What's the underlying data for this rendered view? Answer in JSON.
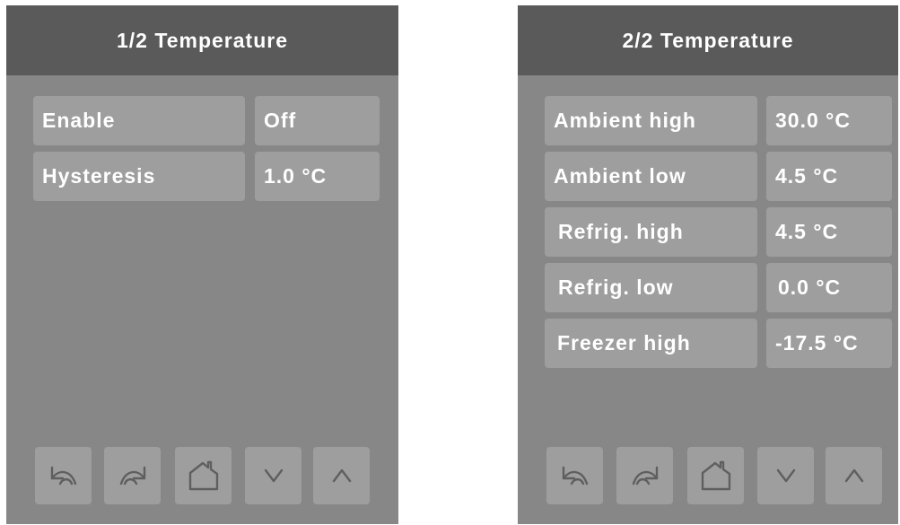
{
  "panels": [
    {
      "title": "1/2 Temperature",
      "rows": [
        {
          "label": "Enable",
          "value": "Off"
        },
        {
          "label": "Hysteresis",
          "value": "1.0 °C"
        }
      ]
    },
    {
      "title": "2/2 Temperature",
      "rows": [
        {
          "label": "Ambient high",
          "value": "30.0 °C"
        },
        {
          "label": "Ambient low",
          "value": "4.5 °C"
        },
        {
          "label": "Refrig. high",
          "value": "4.5 °C"
        },
        {
          "label": "Refrig. low",
          "value": "0.0 °C"
        },
        {
          "label": "Freezer high",
          "value": "-17.5 °C"
        }
      ]
    }
  ],
  "toolbar_icons": [
    "undo-icon",
    "redo-icon",
    "home-icon",
    "chevron-down-icon",
    "chevron-up-icon"
  ],
  "colors": {
    "header_bg": "#595a59",
    "panel_bg": "#878787",
    "cell_bg": "#9e9e9e",
    "text": "#ffffff",
    "icon_stroke": "#5f5f5f"
  }
}
